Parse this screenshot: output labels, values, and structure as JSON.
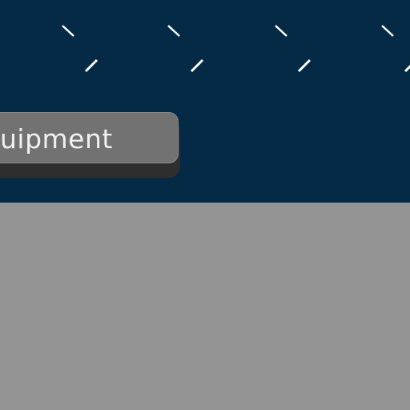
{
  "colors": {
    "header_bg": "#042a45",
    "pattern_stroke": "#ffffff",
    "content_bg": "#949494",
    "tab_bg": "#727272",
    "tab_shadow": "#2e2e2e"
  },
  "header": {
    "pattern_icon": "diagonal-tick-marks"
  },
  "tab": {
    "label": "uipment"
  }
}
